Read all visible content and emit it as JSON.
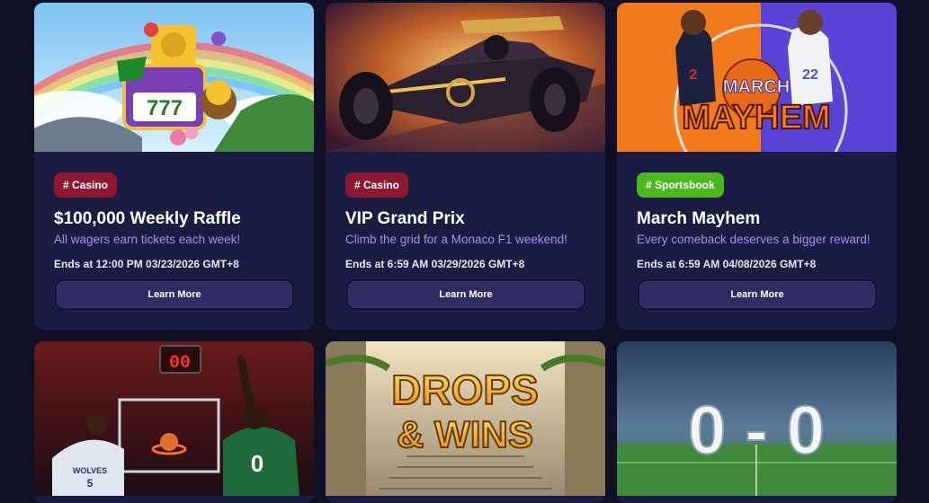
{
  "promotions": [
    {
      "tag": "# Casino",
      "title": "$100,000 Weekly Raffle",
      "subtitle": "All wagers earn tickets each week!",
      "ends": "Ends at 12:00 PM 03/23/2026 GMT+8",
      "button": "Learn More",
      "banner_digits": "777"
    },
    {
      "tag": "# Casino",
      "title": "VIP Grand Prix",
      "subtitle": "Climb the grid for a Monaco F1 weekend!",
      "ends": "Ends at 6:59 AM 03/29/2026 GMT+8",
      "button": "Learn More"
    },
    {
      "tag": "# Sportsbook",
      "title": "March Mayhem",
      "subtitle": "Every comeback deserves a bigger reward!",
      "ends": "Ends at 6:59 AM 04/08/2026 GMT+8",
      "button": "Learn More",
      "banner_line1": "MARCH",
      "banner_line2": "MAYHEM",
      "jersey_left": "2",
      "jersey_right": "22"
    }
  ],
  "row2_banners": [
    {
      "scoreboard": "00",
      "jersey_left": "5",
      "jersey_left_team": "WOLVES",
      "jersey_right": "0"
    },
    {
      "line1": "DROPS",
      "line2": "& WINS"
    },
    {
      "score": "0 - 0"
    }
  ],
  "colors": {
    "background": "#0f1026",
    "card": "#1b1c42",
    "casino_tag": "#8c1834",
    "sportsbook_tag": "#4bb81e",
    "subtitle": "#a98ef0",
    "button": "#302b63"
  }
}
